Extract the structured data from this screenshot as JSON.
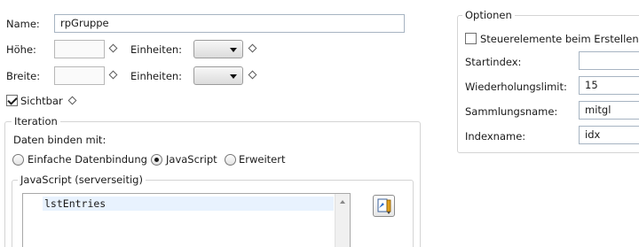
{
  "left": {
    "name_label": "Name:",
    "name_value": "rpGruppe",
    "hoehe_label": "Höhe:",
    "hoehe_value": "",
    "einheiten1_label": "Einheiten:",
    "einheiten1_value": "",
    "breite_label": "Breite:",
    "breite_value": "",
    "einheiten2_label": "Einheiten:",
    "einheiten2_value": "",
    "sichtbar_label": "Sichtbar",
    "sichtbar_checked": true
  },
  "iteration": {
    "title": "Iteration",
    "bind_label": "Daten binden mit:",
    "radio_simple": "Einfache Datenbindung",
    "radio_js": "JavaScript",
    "radio_advanced": "Erweitert",
    "selected": "JavaScript",
    "js_group_title": "JavaScript (serverseitig)",
    "code": "lstEntries"
  },
  "options": {
    "title": "Optionen",
    "create_controls_label": "Steuerelemente beim Erstellen der",
    "create_controls_checked": false,
    "startindex_label": "Startindex:",
    "startindex_value": "",
    "repeat_limit_label": "Wiederholungslimit:",
    "repeat_limit_value": "15",
    "collection_label": "Sammlungsname:",
    "collection_value": "mitgl",
    "index_label": "Indexname:",
    "index_value": "idx"
  }
}
